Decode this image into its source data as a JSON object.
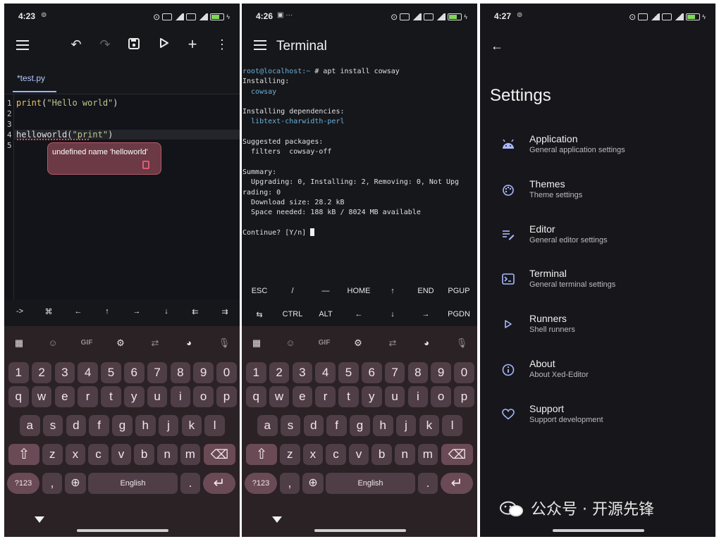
{
  "editor_screen": {
    "status_time": "4:23",
    "tab_label": "*test.py",
    "lines": [
      {
        "num": "1",
        "fn": "print",
        "open": "(",
        "arg": "\"Hello world\"",
        "close": ")"
      },
      {
        "num": "2",
        "text": ""
      },
      {
        "num": "3",
        "text": ""
      },
      {
        "num": "4",
        "fn": "helloworld",
        "open": "(",
        "arg": "\"print\"",
        "close": ")"
      },
      {
        "num": "5",
        "text": ""
      }
    ],
    "diagnostic": "undefined name 'helloworld'",
    "extra_keys": [
      "->",
      "⌘",
      "←",
      "↑",
      "→",
      "↓",
      "⇇",
      "⇉"
    ]
  },
  "terminal_screen": {
    "status_time": "4:26",
    "title": "Terminal",
    "prompt": "root@localhost:~",
    "command": " # apt install cowsay",
    "output": [
      {
        "text": "Installing:",
        "blue": false
      },
      {
        "text": "  cowsay",
        "blue": true
      },
      {
        "text": "",
        "blue": false
      },
      {
        "text": "Installing dependencies:",
        "blue": false
      },
      {
        "text": "  libtext-charwidth-perl",
        "blue": true
      },
      {
        "text": "",
        "blue": false
      },
      {
        "text": "Suggested packages:",
        "blue": false
      },
      {
        "text": "  filters  cowsay-off",
        "blue": false
      },
      {
        "text": "",
        "blue": false
      },
      {
        "text": "Summary:",
        "blue": false
      },
      {
        "text": "  Upgrading: 0, Installing: 2, Removing: 0, Not Upg",
        "blue": false
      },
      {
        "text": "rading: 0",
        "blue": false
      },
      {
        "text": "  Download size: 28.2 kB",
        "blue": false
      },
      {
        "text": "  Space needed: 188 kB / 8024 MB available",
        "blue": false
      },
      {
        "text": "",
        "blue": false
      }
    ],
    "prompt_line": "Continue? [Y/n] ",
    "extra_keys_row1": [
      "ESC",
      "/",
      "—",
      "HOME",
      "↑",
      "END",
      "PGUP"
    ],
    "extra_keys_row2": [
      "⇆",
      "CTRL",
      "ALT",
      "←",
      "↓",
      "→",
      "PGDN"
    ]
  },
  "settings_screen": {
    "status_time": "4:27",
    "title": "Settings",
    "items": [
      {
        "title": "Application",
        "subtitle": "General application settings",
        "icon": "android-icon"
      },
      {
        "title": "Themes",
        "subtitle": "Theme settings",
        "icon": "palette-icon"
      },
      {
        "title": "Editor",
        "subtitle": "General editor settings",
        "icon": "edit-note-icon"
      },
      {
        "title": "Terminal",
        "subtitle": "General terminal settings",
        "icon": "terminal-icon"
      },
      {
        "title": "Runners",
        "subtitle": "Shell runners",
        "icon": "play-icon"
      },
      {
        "title": "About",
        "subtitle": "About Xed-Editor",
        "icon": "info-icon"
      },
      {
        "title": "Support",
        "subtitle": "Support development",
        "icon": "heart-icon"
      }
    ]
  },
  "keyboard": {
    "gif_label": "GIF",
    "numbers": [
      "1",
      "2",
      "3",
      "4",
      "5",
      "6",
      "7",
      "8",
      "9",
      "0"
    ],
    "row1": [
      "q",
      "w",
      "e",
      "r",
      "t",
      "y",
      "u",
      "i",
      "o",
      "p"
    ],
    "row2": [
      "a",
      "s",
      "d",
      "f",
      "g",
      "h",
      "j",
      "k",
      "l"
    ],
    "row3": [
      "z",
      "x",
      "c",
      "v",
      "b",
      "n",
      "m"
    ],
    "sym_label": "?123",
    "comma": ",",
    "space_label": "English",
    "period": "."
  },
  "watermark": "公众号 · 开源先锋",
  "colors": {
    "accent": "#a9b8ff",
    "keyboard_bg": "#2b2226",
    "error": "#e04f5f"
  }
}
